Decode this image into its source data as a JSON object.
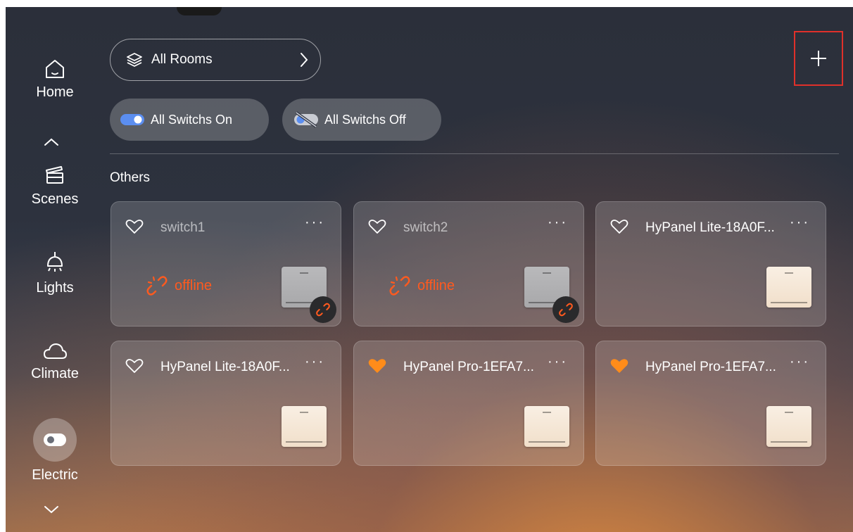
{
  "sidebar": {
    "items": [
      {
        "label": "Home",
        "icon": "home-icon"
      },
      {
        "label": "Scenes",
        "icon": "clapperboard-icon"
      },
      {
        "label": "Lights",
        "icon": "ceiling-lamp-icon"
      },
      {
        "label": "Climate",
        "icon": "cloud-icon"
      },
      {
        "label": "Electric",
        "icon": "toggle-icon",
        "active": true
      }
    ]
  },
  "header": {
    "room_selector": "All Rooms",
    "add_icon": "plus-icon"
  },
  "actions": {
    "all_on": "All Switchs On",
    "all_off": "All Switchs Off"
  },
  "section": {
    "title": "Others"
  },
  "devices": [
    {
      "name": "switch1",
      "status": "offline",
      "favorite": false
    },
    {
      "name": "switch2",
      "status": "offline",
      "favorite": false
    },
    {
      "name": "HyPanel Lite-18A0F...",
      "status": "online",
      "favorite": false
    },
    {
      "name": "HyPanel Lite-18A0F...",
      "status": "online",
      "favorite": false
    },
    {
      "name": "HyPanel Pro-1EFA7...",
      "status": "online",
      "favorite": true
    },
    {
      "name": "HyPanel Pro-1EFA7...",
      "status": "online",
      "favorite": true
    }
  ],
  "colors": {
    "offline": "#ff5a1f",
    "favorite": "#ff8c1a",
    "highlight_box": "#e0302a"
  }
}
